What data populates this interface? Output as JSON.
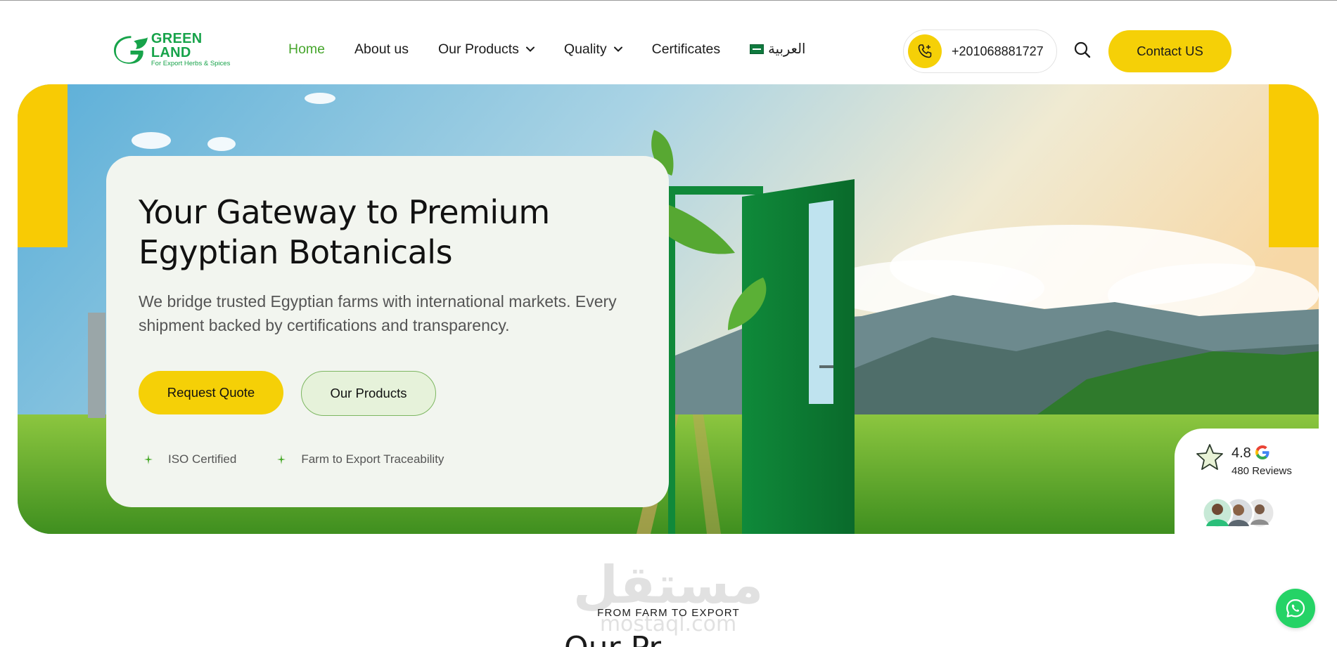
{
  "brand": {
    "name": "GREEN LAND",
    "tagline": "For Export Herbs & Spices",
    "primary_green": "#17a34a",
    "accent_yellow": "#f5d007"
  },
  "nav": {
    "items": [
      {
        "label": "Home",
        "active": true,
        "dropdown": false
      },
      {
        "label": "About us",
        "active": false,
        "dropdown": false
      },
      {
        "label": "Our Products",
        "active": false,
        "dropdown": true
      },
      {
        "label": "Quality",
        "active": false,
        "dropdown": true
      },
      {
        "label": "Certificates",
        "active": false,
        "dropdown": false
      }
    ],
    "language_label": "العربية",
    "language_icon": "saudi-flag-icon",
    "phone": "+201068881727",
    "phone_icon": "phone-icon",
    "search_icon": "search-icon",
    "contact_label": "Contact US"
  },
  "hero": {
    "title": "Your Gateway to Premium Egyptian Botanicals",
    "description": "We bridge trusted Egyptian farms with international markets. Every shipment backed by certifications and transparency.",
    "primary_cta": "Request Quote",
    "secondary_cta": "Our Products",
    "badges": [
      "ISO Certified",
      "Farm to Export Traceability"
    ]
  },
  "rating": {
    "score": "4.8",
    "reviews": "480 Reviews",
    "provider_icon": "google-icon",
    "star_icon": "star-icon"
  },
  "section": {
    "kicker": "FROM FARM TO EXPORT",
    "title": "Our Pr"
  },
  "watermark": {
    "text_ar": "مستقل",
    "text_en": "mostaql.com"
  },
  "floating": {
    "whatsapp_icon": "whatsapp-icon"
  }
}
